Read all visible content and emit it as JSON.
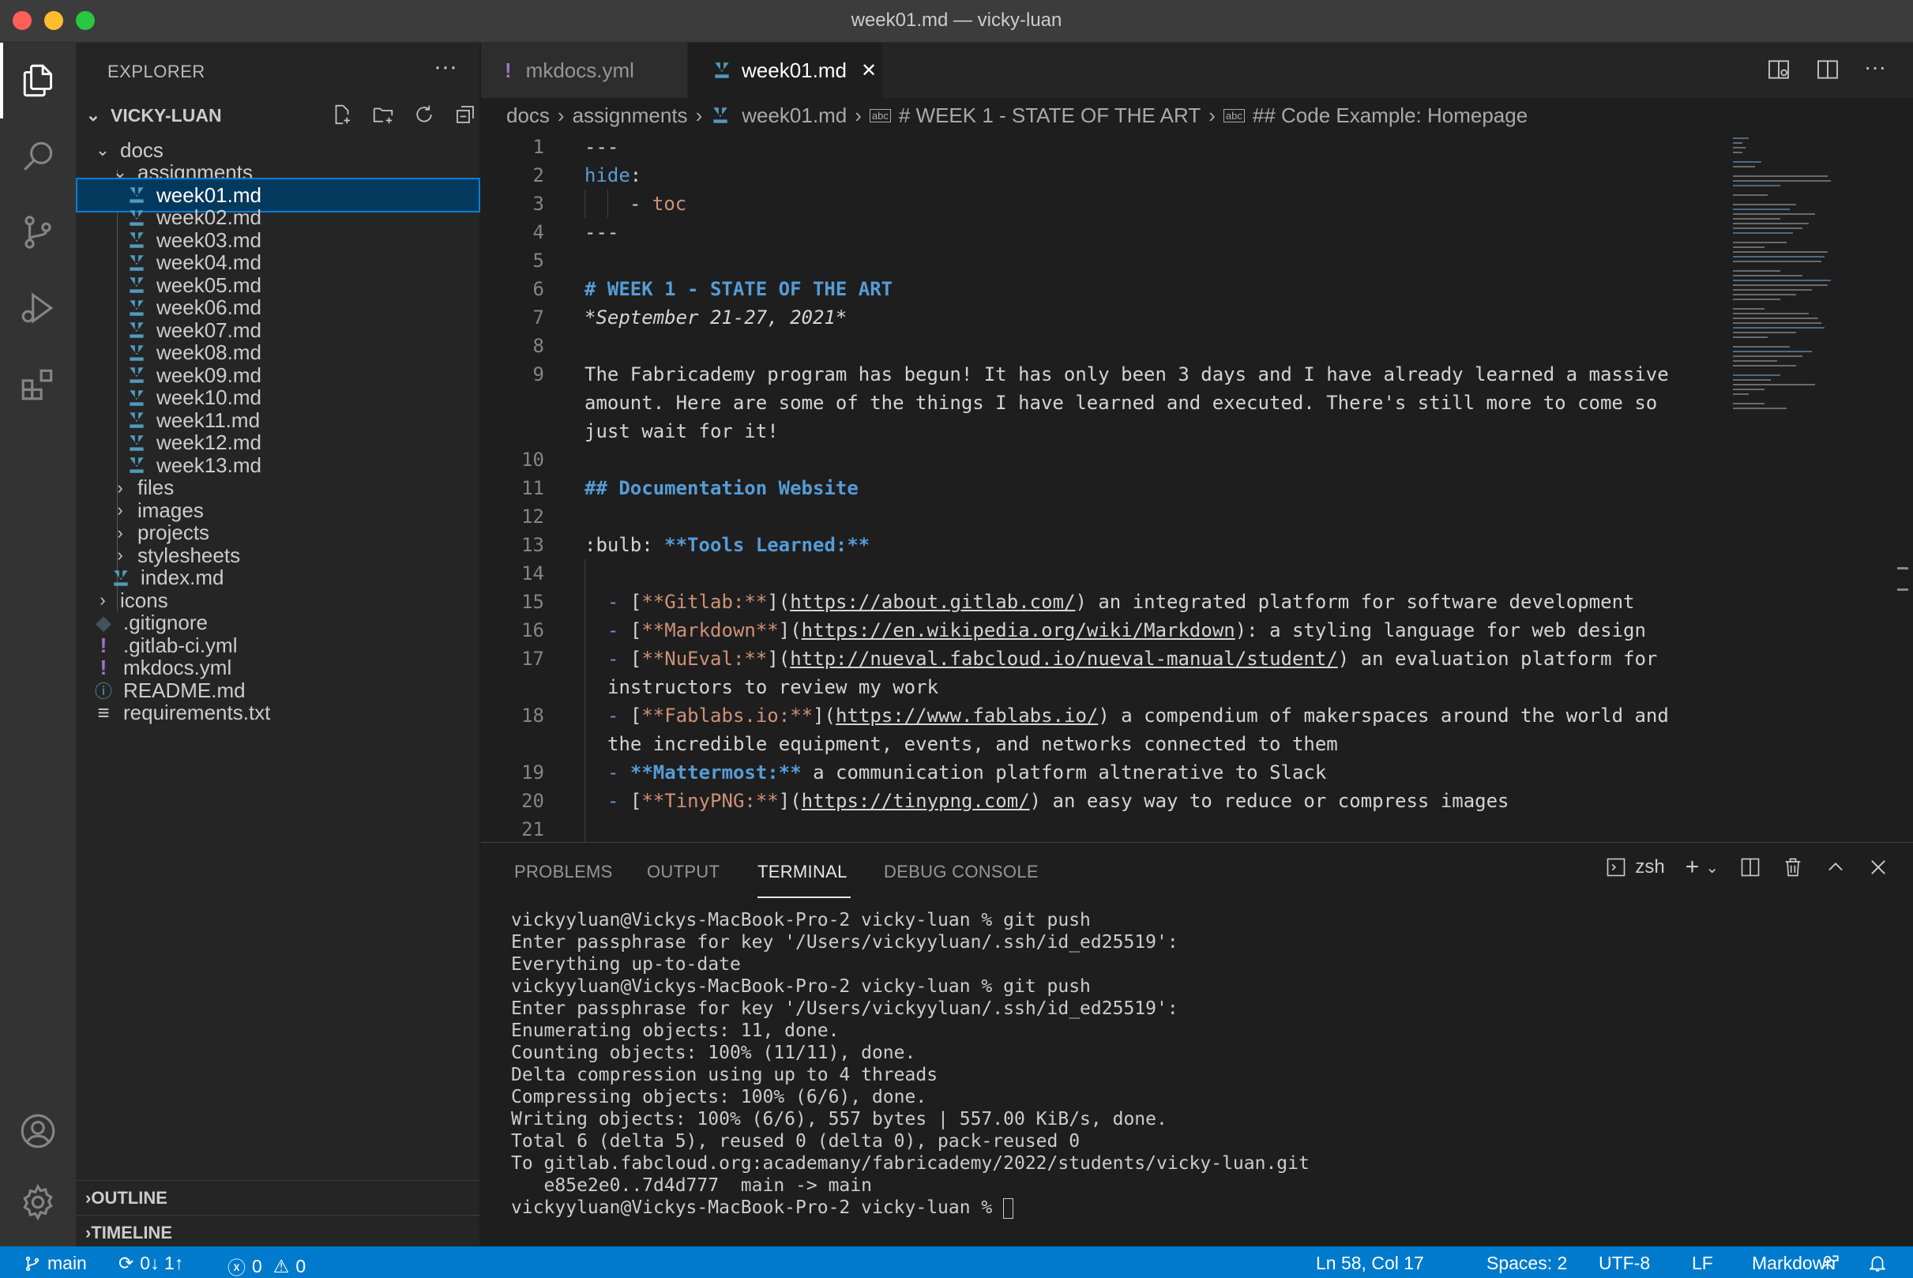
{
  "window": {
    "title": "week01.md — vicky-luan"
  },
  "activity_bar": {
    "icons": [
      "explorer-icon",
      "search-icon",
      "source-control-icon",
      "run-debug-icon",
      "extensions-icon",
      "account-icon",
      "gear-icon"
    ]
  },
  "explorer": {
    "header": "EXPLORER",
    "more": "···",
    "project": "VICKY-LUAN",
    "tree": [
      {
        "label": "docs",
        "type": "folder-open"
      },
      {
        "label": "assignments",
        "type": "folder-open"
      },
      {
        "label": "week01.md",
        "type": "md",
        "selected": true
      },
      {
        "label": "week02.md",
        "type": "md"
      },
      {
        "label": "week03.md",
        "type": "md"
      },
      {
        "label": "week04.md",
        "type": "md"
      },
      {
        "label": "week05.md",
        "type": "md"
      },
      {
        "label": "week06.md",
        "type": "md"
      },
      {
        "label": "week07.md",
        "type": "md"
      },
      {
        "label": "week08.md",
        "type": "md"
      },
      {
        "label": "week09.md",
        "type": "md"
      },
      {
        "label": "week10.md",
        "type": "md"
      },
      {
        "label": "week11.md",
        "type": "md"
      },
      {
        "label": "week12.md",
        "type": "md"
      },
      {
        "label": "week13.md",
        "type": "md"
      },
      {
        "label": "files",
        "type": "folder"
      },
      {
        "label": "images",
        "type": "folder"
      },
      {
        "label": "projects",
        "type": "folder"
      },
      {
        "label": "stylesheets",
        "type": "folder"
      },
      {
        "label": "index.md",
        "type": "md"
      },
      {
        "label": "icons",
        "type": "folder"
      },
      {
        "label": ".gitignore",
        "type": "git"
      },
      {
        "label": ".gitlab-ci.yml",
        "type": "yml"
      },
      {
        "label": "mkdocs.yml",
        "type": "yml"
      },
      {
        "label": "README.md",
        "type": "info"
      },
      {
        "label": "requirements.txt",
        "type": "txt"
      }
    ],
    "outline": "OUTLINE",
    "timeline": "TIMELINE"
  },
  "tabs": [
    {
      "label": "mkdocs.yml",
      "active": false
    },
    {
      "label": "week01.md",
      "active": true,
      "close": "✕"
    }
  ],
  "breadcrumb": [
    "docs",
    "assignments",
    "week01.md",
    "# WEEK 1 - STATE OF THE ART",
    "## Code Example: Homepage"
  ],
  "editor": {
    "line_numbers": [
      "1",
      "2",
      "3",
      "4",
      "5",
      "6",
      "7",
      "8",
      "9",
      "10",
      "11",
      "12",
      "13",
      "14",
      "15",
      "16",
      "17",
      "18",
      "19",
      "20",
      "21"
    ],
    "l1": "---",
    "l2_key": "hide",
    "l2_colon": ":",
    "l3_dash": "- ",
    "l3_val": "toc",
    "l4": "---",
    "l6": "# WEEK 1 - STATE OF THE ART",
    "l7": "*September 21-27, 2021*",
    "l9a": "The Fabricademy program has begun! It has only been 3 days and I have already learned a massive",
    "l9b": "amount. Here are some of the things I have learned and executed. There's still more to come so",
    "l9c": "just wait for it!",
    "l11": "## Documentation Website",
    "l13_pre": ":bulb: ",
    "l13_bold": "**Tools Learned:**",
    "l15": {
      "name": "**Gitlab:**",
      "url": "https://about.gitlab.com/",
      "desc": ") an integrated platform for software development"
    },
    "l16": {
      "name": "**Markdown**",
      "url": "https://en.wikipedia.org/wiki/Markdown",
      "desc": "): a styling language for web design"
    },
    "l17": {
      "name": "**NuEval:**",
      "url": "http://nueval.fabcloud.io/nueval-manual/student/",
      "desc": ") an evaluation platform for",
      "cont": "instructors to review my work"
    },
    "l18": {
      "name": "**Fablabs.io:**",
      "url": "https://www.fablabs.io/",
      "desc": ") a compendium of makerspaces around the world and",
      "cont": "the incredible equipment, events, and networks connected to them"
    },
    "l19": {
      "bold": "**Mattermost:**",
      "desc": " a communication platform altnerative to Slack"
    },
    "l20": {
      "name": "**TinyPNG:**",
      "url": "https://tinypng.com/",
      "desc": ") an easy way to reduce or compress images"
    }
  },
  "panel": {
    "tabs": [
      "PROBLEMS",
      "OUTPUT",
      "TERMINAL",
      "DEBUG CONSOLE"
    ],
    "active_tab": "TERMINAL",
    "shell": "zsh",
    "terminal_lines": [
      "vickyyluan@Vickys-MacBook-Pro-2 vicky-luan % git push",
      "Enter passphrase for key '/Users/vickyyluan/.ssh/id_ed25519':",
      "Everything up-to-date",
      "vickyyluan@Vickys-MacBook-Pro-2 vicky-luan % git push",
      "Enter passphrase for key '/Users/vickyyluan/.ssh/id_ed25519':",
      "Enumerating objects: 11, done.",
      "Counting objects: 100% (11/11), done.",
      "Delta compression using up to 4 threads",
      "Compressing objects: 100% (6/6), done.",
      "Writing objects: 100% (6/6), 557 bytes | 557.00 KiB/s, done.",
      "Total 6 (delta 5), reused 0 (delta 0), pack-reused 0",
      "To gitlab.fabcloud.org:academany/fabricademy/2022/students/vicky-luan.git",
      "   e85e2e0..7d4d777  main -> main"
    ],
    "prompt": "vickyyluan@Vickys-MacBook-Pro-2 vicky-luan % "
  },
  "status_bar": {
    "branch": "main",
    "sync": "0↓ 1↑",
    "errors": "0",
    "warnings": "0",
    "position": "Ln 58, Col 17",
    "spaces": "Spaces: 2",
    "encoding": "UTF-8",
    "eol": "LF",
    "language": "Markdown"
  },
  "colors": {
    "accent": "#007acc",
    "md_icon": "#519aba",
    "yml_icon": "#a074c4",
    "heading": "#569cd6",
    "string": "#ce9178"
  }
}
